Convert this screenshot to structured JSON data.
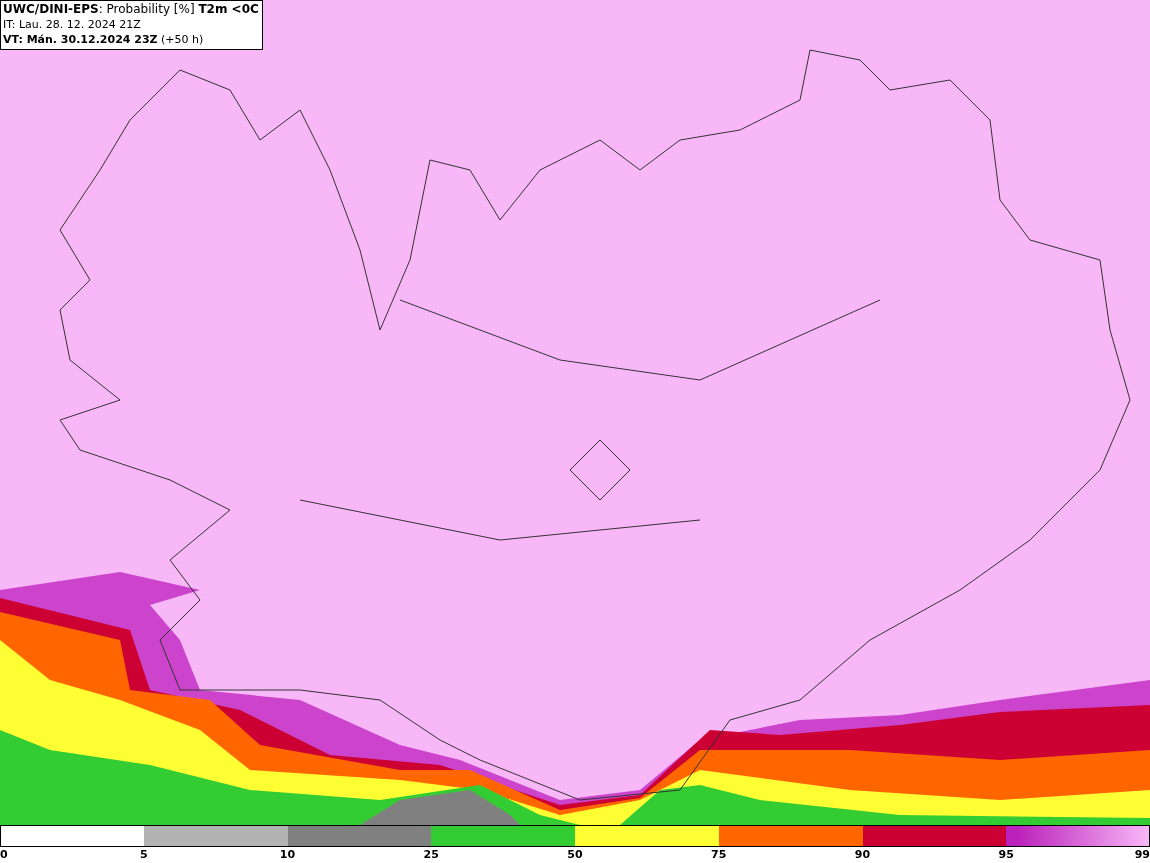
{
  "header": {
    "title": "**UWC/DINI-EPS**: Probability [%] **T2m <0C**",
    "init_time": "IT: Lau. 28. 12. 2024 21Z",
    "valid_time": "**VT: Mán. 30.12.2024 23Z** (+50 h)"
  },
  "legend": {
    "bins": [
      {
        "color": "#ffffff"
      },
      {
        "color": "#b3b3b3"
      },
      {
        "color": "#808080"
      },
      {
        "color": "#33cc33"
      },
      {
        "color": "#ffff33"
      },
      {
        "color": "#ff6600"
      },
      {
        "color": "#cc0033"
      },
      {
        "color": "#bb22bb",
        "kind": "gradient"
      }
    ],
    "ticks": [
      "0",
      "5",
      "10",
      "25",
      "50",
      "75",
      "90",
      "95",
      "99"
    ]
  }
}
